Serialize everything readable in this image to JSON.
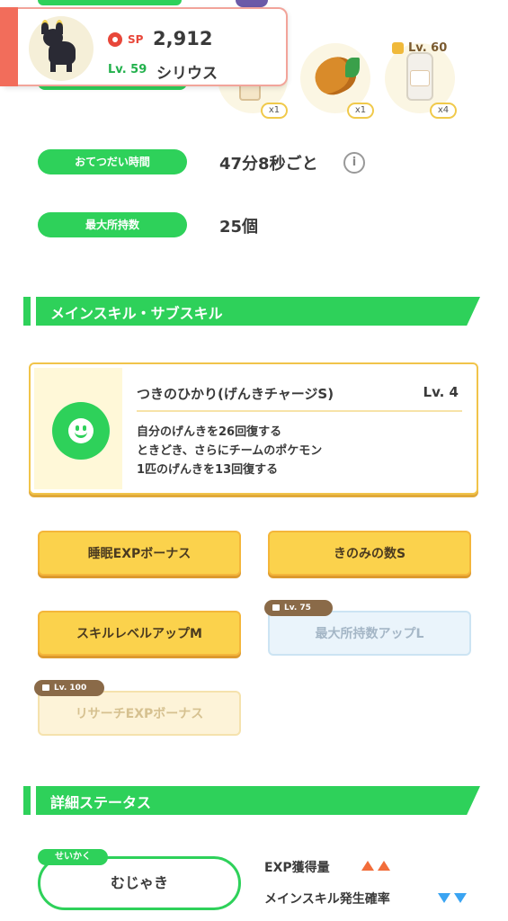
{
  "pokemon": {
    "sp_label": "SP",
    "sp_value": "2,912",
    "level": "Lv. 59",
    "name": "シリウス"
  },
  "ingredients": [
    {
      "icon": "ingredient-icon",
      "count": "x1"
    },
    {
      "icon": "cacao-icon",
      "count": "x1"
    },
    {
      "icon": "milk-icon",
      "count": "x4",
      "lock_level": "Lv. 60"
    }
  ],
  "status": {
    "help_time_label": "おてつだい時間",
    "help_time_value": "47分8秒ごと",
    "max_carry_label": "最大所持数",
    "max_carry_value": "25個"
  },
  "skills_section": {
    "title": "メインスキル・サブスキル",
    "main_skill": {
      "name": "つきのひかり(げんきチャージS)",
      "level": "Lv. 4",
      "desc_line1": "自分のげんきを26回復する",
      "desc_line2": "ときどき、さらにチームのポケモン",
      "desc_line3": "1匹のげんきを13回復する"
    },
    "sub_skills": [
      {
        "label": "睡眠EXPボーナス",
        "locked": false
      },
      {
        "label": "きのみの数S",
        "locked": false
      },
      {
        "label": "スキルレベルアップM",
        "locked": false
      },
      {
        "label": "最大所持数アップL",
        "locked": true,
        "lock_level": "Lv. 75"
      },
      {
        "label": "リサーチEXPボーナス",
        "locked": true,
        "lock_level": "Lv. 100"
      }
    ]
  },
  "details_section": {
    "title": "詳細ステータス",
    "nature_tag": "せいかく",
    "nature_value": "むじゃき",
    "stat_up": "EXP獲得量",
    "stat_down": "メインスキル発生確率"
  },
  "colors": {
    "accent_green": "#2ed15a",
    "accent_red": "#f26d5b",
    "gold": "#fbd24c",
    "up_arrow": "#f26d3a",
    "down_arrow": "#3aa4f2"
  }
}
